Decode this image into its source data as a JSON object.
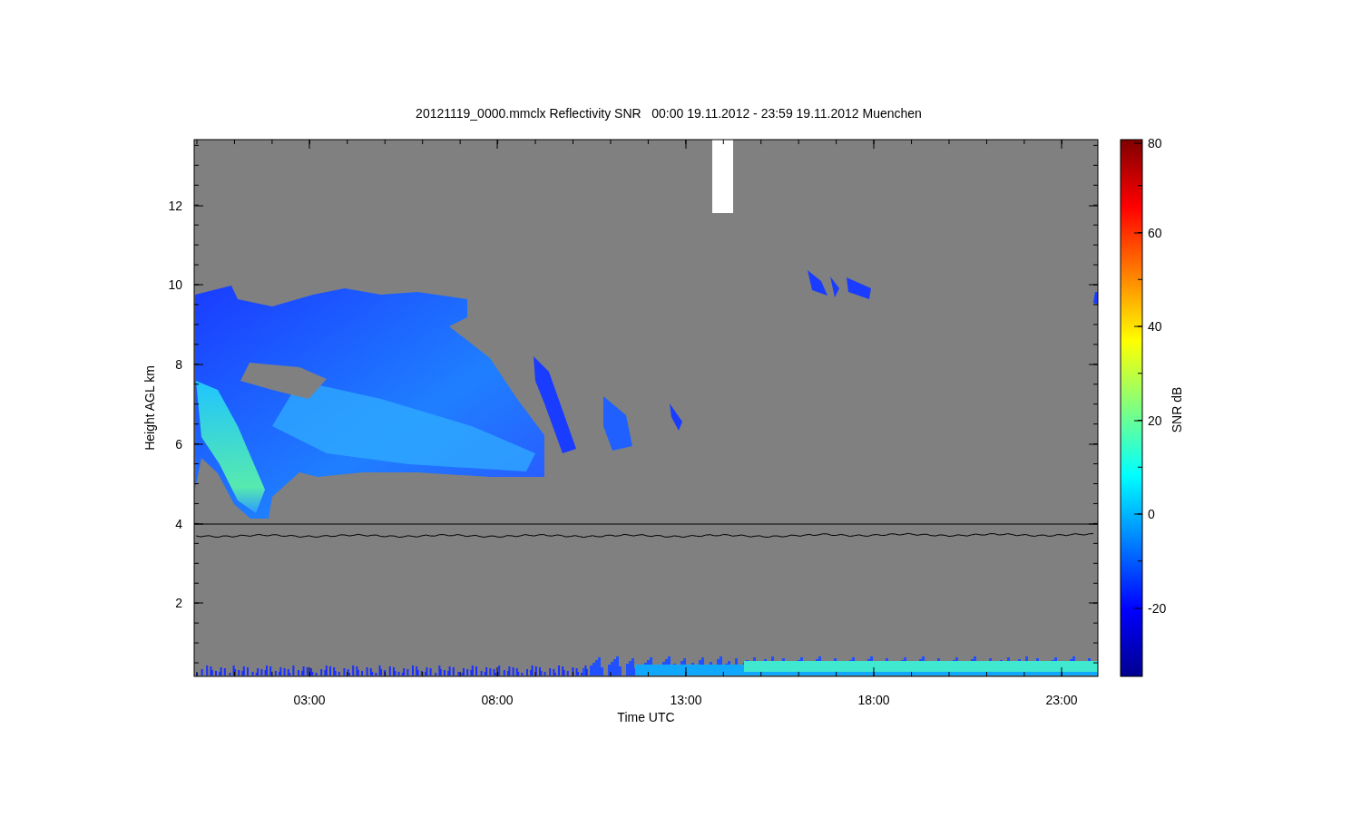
{
  "title": "20121119_0000.mmclx Reflectivity SNR   00:00 19.11.2012 - 23:59 19.11.2012 Muenchen",
  "xlabel": "Time UTC",
  "ylabel": "Height AGL km",
  "xticks": [
    "03:00",
    "08:00",
    "13:00",
    "18:00",
    "23:00"
  ],
  "yticks": [
    "12",
    "10",
    "8",
    "6",
    "4",
    "2"
  ],
  "colorbar": {
    "label": "SNR dB",
    "ticks": [
      "80",
      "60",
      "40",
      "20",
      "0",
      "-20"
    ]
  }
}
